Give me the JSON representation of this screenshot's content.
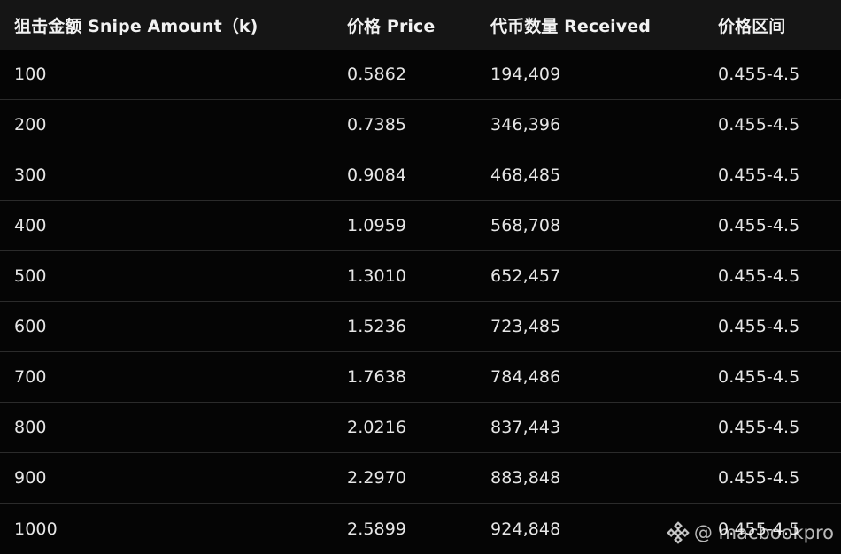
{
  "table": {
    "headers": [
      "狙击金额 Snipe Amount（k)",
      "价格 Price",
      "代币数量 Received",
      "价格区间"
    ],
    "rows": [
      [
        "100",
        "0.5862",
        "194,409",
        "0.455-4.5"
      ],
      [
        "200",
        "0.7385",
        "346,396",
        "0.455-4.5"
      ],
      [
        "300",
        "0.9084",
        "468,485",
        "0.455-4.5"
      ],
      [
        "400",
        "1.0959",
        "568,708",
        "0.455-4.5"
      ],
      [
        "500",
        "1.3010",
        "652,457",
        "0.455-4.5"
      ],
      [
        "600",
        "1.5236",
        "723,485",
        "0.455-4.5"
      ],
      [
        "700",
        "1.7638",
        "784,486",
        "0.455-4.5"
      ],
      [
        "800",
        "2.0216",
        "837,443",
        "0.455-4.5"
      ],
      [
        "900",
        "2.2970",
        "883,848",
        "0.455-4.5"
      ],
      [
        "1000",
        "2.5899",
        "924,848",
        "0.455-4.5"
      ]
    ]
  },
  "watermark": {
    "text": "@ macbookpro",
    "icon": "binance-logo-icon"
  }
}
